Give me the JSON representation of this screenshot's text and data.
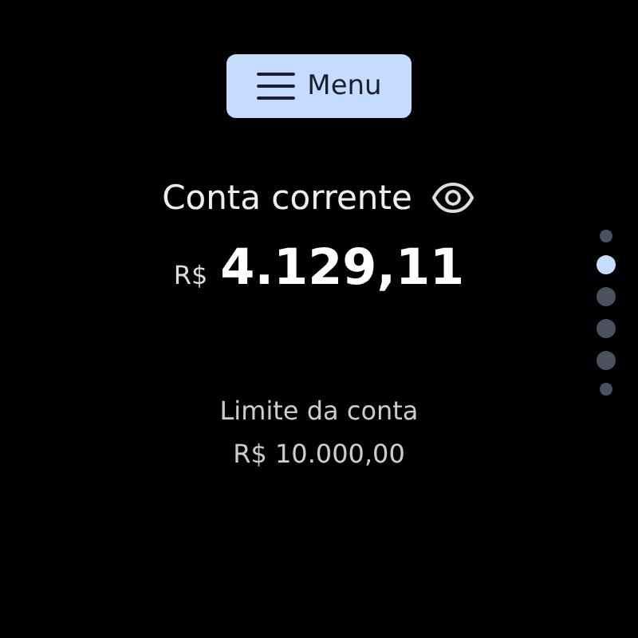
{
  "menu_button": {
    "label": "Menu"
  },
  "account": {
    "title": "Conta corrente",
    "currency": "R$",
    "balance": "4.129,11"
  },
  "limit": {
    "label": "Limite da conta",
    "value": "R$ 10.000,00"
  },
  "page_indicator": [
    {
      "kind": "edge",
      "selected": false
    },
    {
      "kind": "page",
      "selected": true
    },
    {
      "kind": "page",
      "selected": false
    },
    {
      "kind": "page",
      "selected": false
    },
    {
      "kind": "page",
      "selected": false
    },
    {
      "kind": "edge",
      "selected": false
    }
  ]
}
